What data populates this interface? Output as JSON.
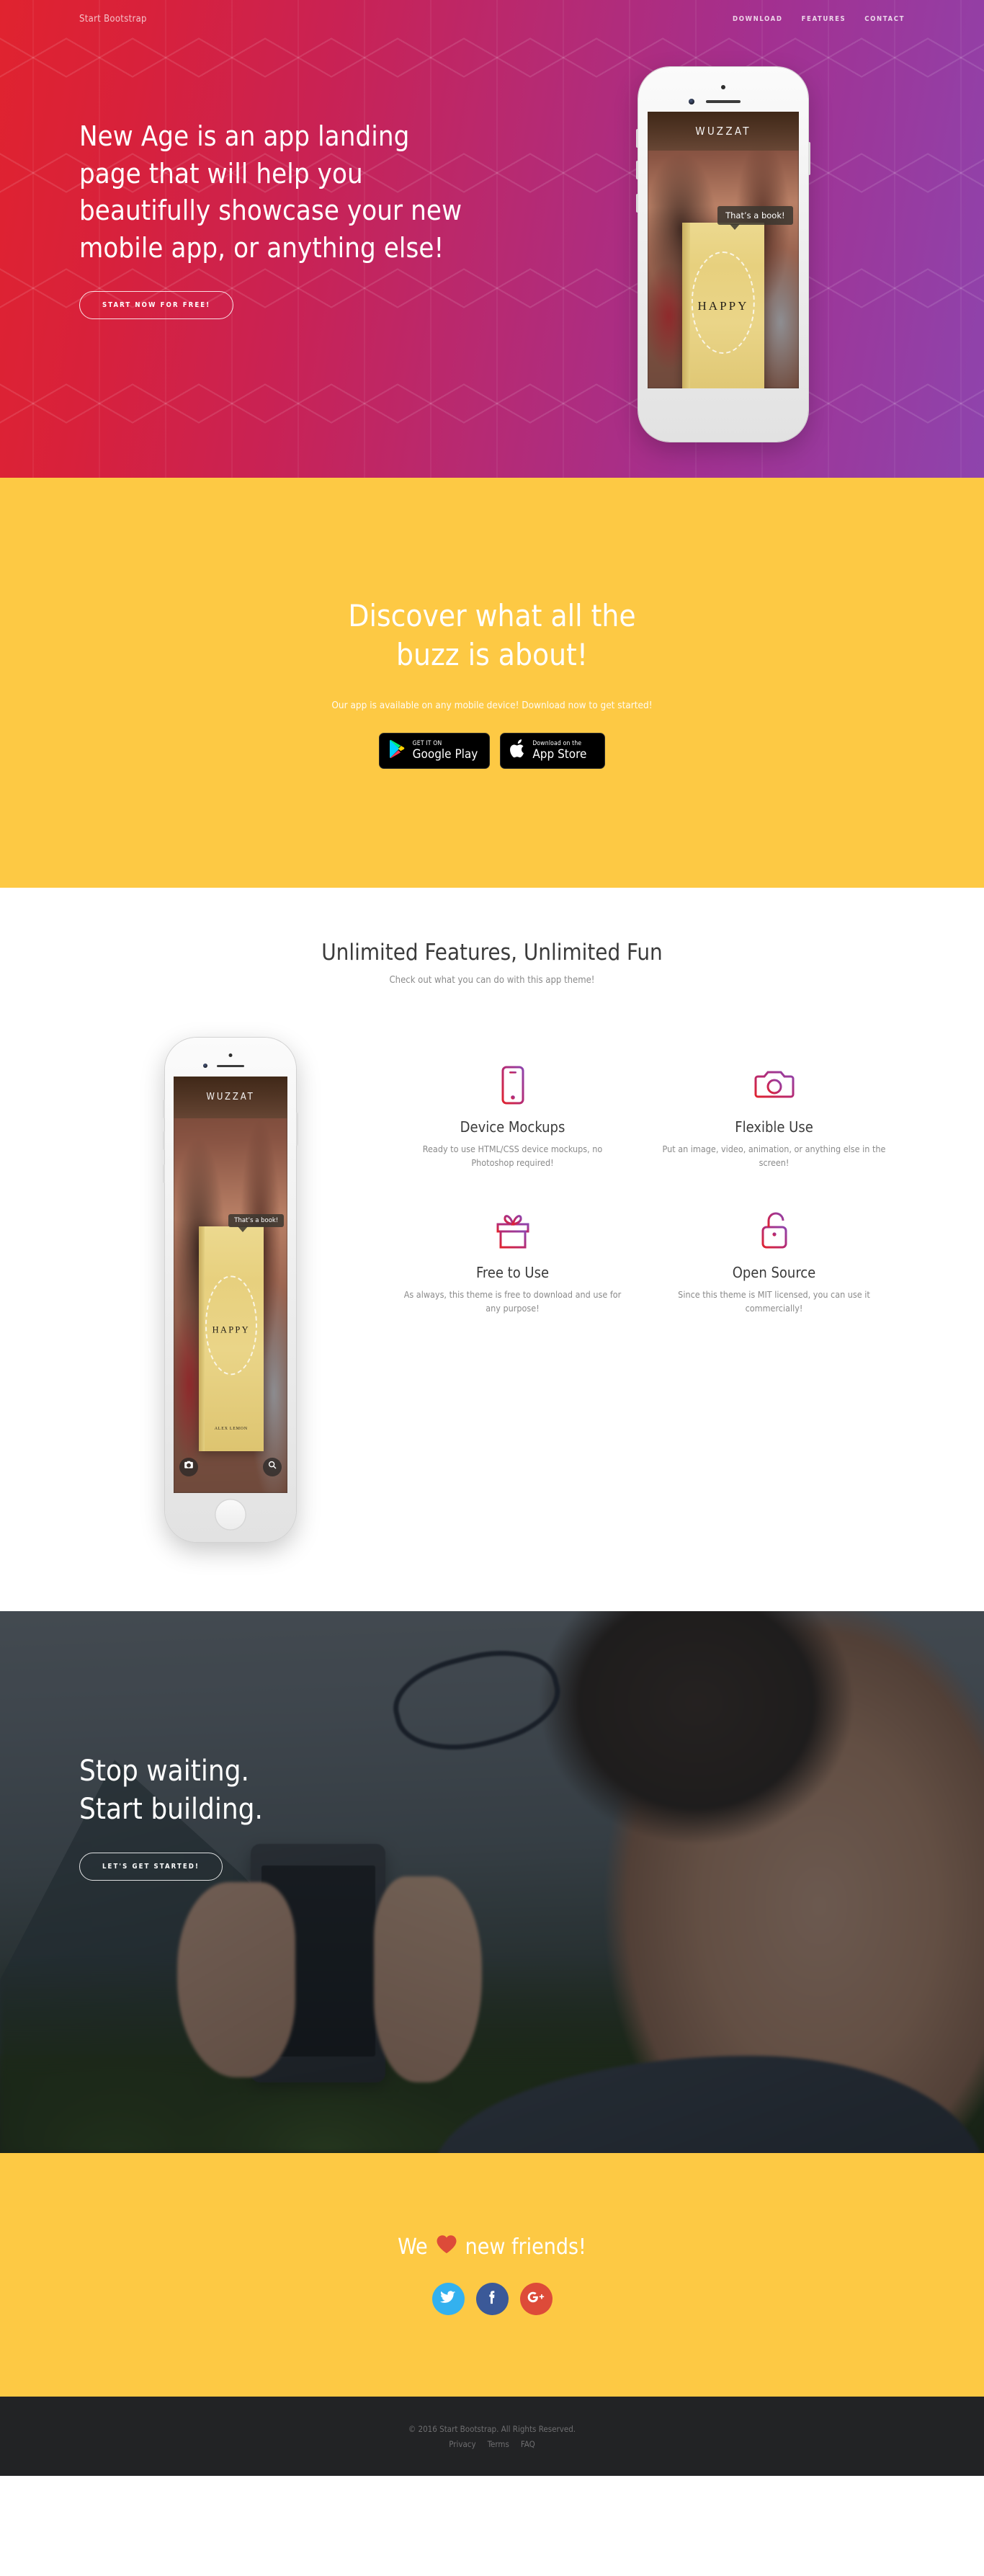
{
  "navbar": {
    "brand": "Start Bootstrap",
    "links": [
      {
        "label": "Download"
      },
      {
        "label": "Features"
      },
      {
        "label": "Contact"
      }
    ]
  },
  "hero": {
    "heading_lines": [
      "New Age is an app landing",
      "page that will help you",
      "beautifully showcase your new",
      "mobile app, or anything else!"
    ],
    "cta_label": "Start Now for Free!",
    "gradient_start": "#e0232f",
    "gradient_end": "#8e44ad"
  },
  "phone_app": {
    "title": "WUZZAT",
    "bubble_text": "That’s a book!",
    "book_title": "HAPPY",
    "book_author": "ALEX LEMON",
    "camera_icon": "camera-icon",
    "search_icon": "search-icon"
  },
  "download": {
    "heading_lines": [
      "Discover what all the",
      "buzz is about!"
    ],
    "subtitle": "Our app is available on any mobile device! Download now to get started!",
    "badges": [
      {
        "small": "GET IT ON",
        "big": "Google Play",
        "icon": "google-play-icon"
      },
      {
        "small": "Download on the",
        "big": "App Store",
        "icon": "apple-icon"
      }
    ],
    "background": "#fdc944"
  },
  "features": {
    "heading": "Unlimited Features, Unlimited Fun",
    "subtitle": "Check out what you can do with this app theme!",
    "items": [
      {
        "icon": "mobile-phone-icon",
        "title": "Device Mockups",
        "text": "Ready to use HTML/CSS device mockups, no Photoshop required!"
      },
      {
        "icon": "camera-icon",
        "title": "Flexible Use",
        "text": "Put an image, video, animation, or anything else in the screen!"
      },
      {
        "icon": "gift-icon",
        "title": "Free to Use",
        "text": "As always, this theme is free to download and use for any purpose!"
      },
      {
        "icon": "unlock-icon",
        "title": "Open Source",
        "text": "Since this theme is MIT licensed, you can use it commercially!"
      }
    ]
  },
  "cta": {
    "heading_lines": [
      "Stop waiting.",
      "Start building."
    ],
    "button_label": "Let's Get Started!"
  },
  "contact": {
    "heading_prefix": "We",
    "heading_suffix": "new friends!",
    "heart_icon": "heart-icon",
    "heart_color": "#dd4b39",
    "socials": [
      {
        "icon": "twitter-icon",
        "color": "#33b1ef",
        "label": "Twitter"
      },
      {
        "icon": "facebook-icon",
        "color": "#3b5998",
        "label": "Facebook"
      },
      {
        "icon": "google-plus-icon",
        "color": "#dd4b39",
        "label": "Google Plus"
      }
    ]
  },
  "footer": {
    "copyright": "© 2016 Start Bootstrap. All Rights Reserved.",
    "links": [
      {
        "label": "Privacy"
      },
      {
        "label": "Terms"
      },
      {
        "label": "FAQ"
      }
    ]
  }
}
